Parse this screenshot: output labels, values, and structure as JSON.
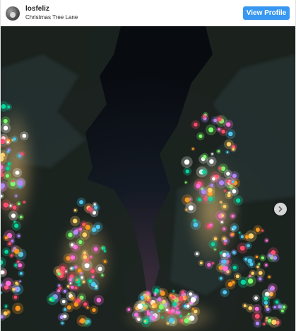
{
  "header": {
    "username": "losfeliz",
    "location": "Christmas Tree Lane",
    "view_profile_label": "View Profile"
  },
  "icons": {
    "avatar": "profile-photo",
    "next": "chevron-right-icon"
  },
  "colors": {
    "accent": "#3897f0",
    "text": "#262626",
    "sky": "#0b0f14"
  }
}
